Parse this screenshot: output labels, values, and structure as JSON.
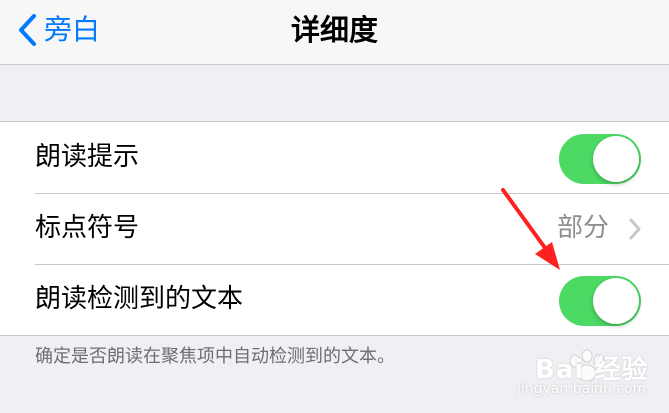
{
  "navbar": {
    "back_label": "旁白",
    "title": "详细度"
  },
  "settings": {
    "rows": [
      {
        "label": "朗读提示",
        "type": "toggle",
        "on": true
      },
      {
        "label": "标点符号",
        "type": "disclosure",
        "value": "部分"
      },
      {
        "label": "朗读检测到的文本",
        "type": "toggle",
        "on": true
      }
    ],
    "footer": "确定是否朗读在聚焦项中自动检测到的文本。"
  },
  "watermark": {
    "brand": "Bai 经验",
    "url": "jingyan.baidu.com"
  },
  "colors": {
    "accent": "#007aff",
    "toggle_on": "#4cd964",
    "arrow": "#ff2020"
  },
  "icons": {
    "back": "chevron-left-icon",
    "disclosure": "chevron-right-icon"
  }
}
